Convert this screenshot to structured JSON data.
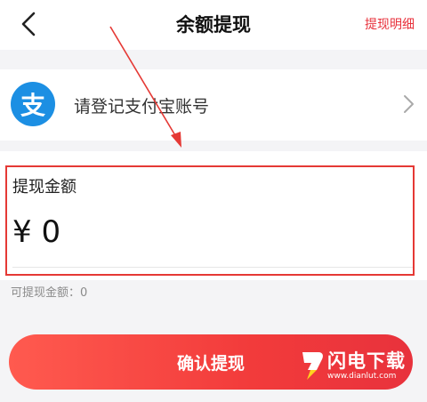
{
  "header": {
    "title": "余额提现",
    "detail_link": "提现明细"
  },
  "alipay": {
    "logo_char": "支",
    "label": "请登记支付宝账号"
  },
  "amount": {
    "label": "提现金额",
    "value": "¥ 0",
    "available": "可提现金额：0"
  },
  "confirm": {
    "label": "确认提现"
  },
  "watermark": {
    "name": "闪电下载",
    "url": "www.dianlut.com"
  },
  "colors": {
    "accent": "#e8323c",
    "alipay_blue": "#1c8fe3",
    "annotation_red": "#e53935"
  },
  "icons": {
    "back": "chevron-left-icon",
    "row_arrow": "chevron-right-icon",
    "alipay": "alipay-icon"
  }
}
